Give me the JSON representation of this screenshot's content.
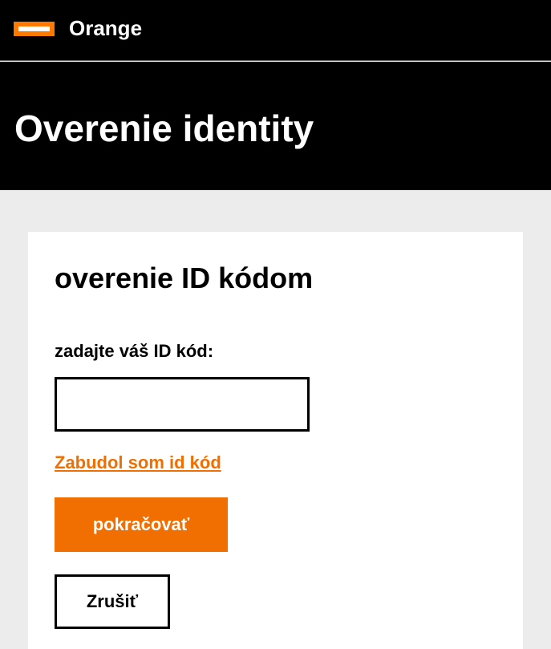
{
  "header": {
    "brand_name": "Orange",
    "logo_icon": "orange-logo-icon"
  },
  "page": {
    "title": "Overenie identity"
  },
  "form": {
    "title": "overenie ID kódom",
    "field_label": "zadajte váš ID kód:",
    "id_input_value": "",
    "id_input_placeholder": "",
    "forgot_link": "Zabudol som id kód",
    "continue_label": "pokračovať",
    "cancel_label": "Zrušiť"
  },
  "colors": {
    "brand_orange": "#ff7900",
    "accent_orange": "#f16e00",
    "header_bg": "#000000",
    "page_bg": "#ececec",
    "card_bg": "#ffffff"
  }
}
